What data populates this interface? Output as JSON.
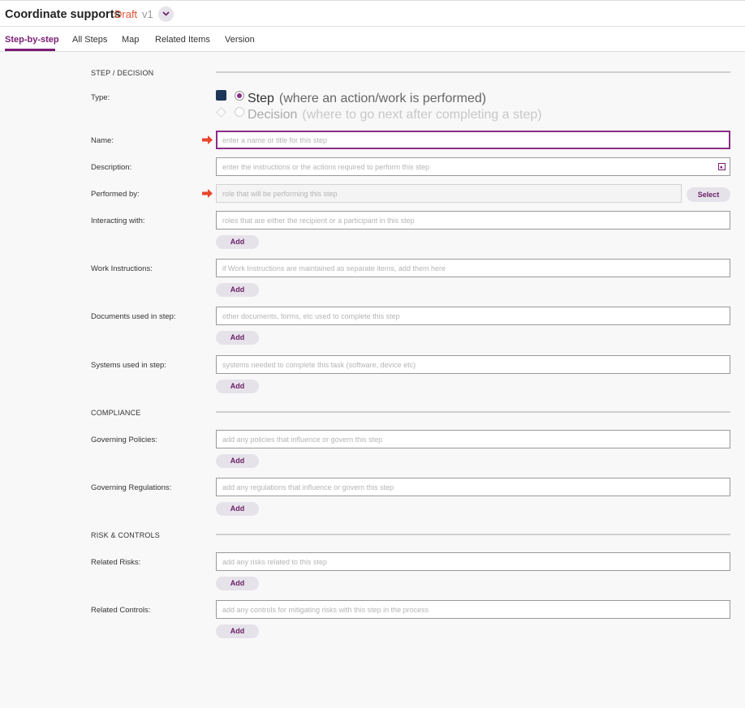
{
  "header": {
    "title": "Coordinate supports",
    "status": "Draft",
    "version": "v1"
  },
  "tabs": [
    {
      "label": "Step-by-step"
    },
    {
      "label": "All Steps"
    },
    {
      "label": "Map"
    },
    {
      "label": "Related Items"
    },
    {
      "label": "Version"
    }
  ],
  "sections": {
    "step_decision": "STEP / DECISION",
    "compliance": "COMPLIANCE",
    "risk_controls": "RISK & CONTROLS"
  },
  "type": {
    "label": "Type:",
    "step_label": "Step",
    "step_hint": "(where an action/work is performed)",
    "decision_label": "Decision",
    "decision_hint": "(where to go next after completing a step)"
  },
  "fields": {
    "name": {
      "label": "Name:",
      "placeholder": "enter a name or title for this step"
    },
    "description": {
      "label": "Description:",
      "placeholder": "enter the instructions or the actions required to perform this step"
    },
    "performed_by": {
      "label": "Performed by:",
      "placeholder": "role that will be performing this step",
      "button": "Select"
    },
    "interacting_with": {
      "label": "Interacting with:",
      "placeholder": "roles that are either the recipient or a participant in this step",
      "button": "Add"
    },
    "work_instructions": {
      "label": "Work Instructions:",
      "placeholder": "if Work Instructions are maintained as separate items, add them here",
      "button": "Add"
    },
    "documents": {
      "label": "Documents used in step:",
      "placeholder": "other documents, forms, etc used to complete this step",
      "button": "Add"
    },
    "systems": {
      "label": "Systems used in step:",
      "placeholder": "systems needed to complete this task (software, device etc)",
      "button": "Add"
    },
    "policies": {
      "label": "Governing Policies:",
      "placeholder": "add any policies that influence or govern this step",
      "button": "Add"
    },
    "regulations": {
      "label": "Governing Regulations:",
      "placeholder": "add any regulations that influence or govern this step",
      "button": "Add"
    },
    "risks": {
      "label": "Related Risks:",
      "placeholder": "add any risks related to this step",
      "button": "Add"
    },
    "controls": {
      "label": "Related Controls:",
      "placeholder": "add any controls for mitigating risks with this step in the process",
      "button": "Add"
    }
  },
  "colors": {
    "accent": "#7a1d74",
    "draft": "#e0563a",
    "required_arrow": "#e8452c",
    "step_square": "#1d3557"
  },
  "icons": {
    "chevron": "chevron-down-icon",
    "required": "arrow-right-icon",
    "expand": "expand-icon"
  }
}
